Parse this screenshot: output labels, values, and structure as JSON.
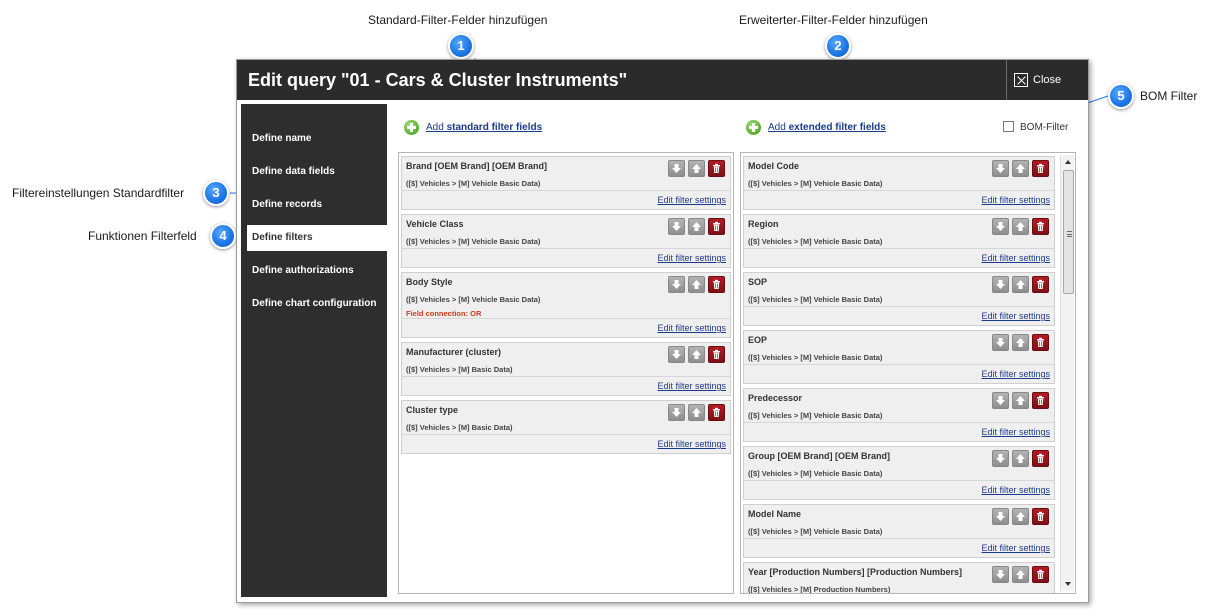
{
  "annotations": {
    "a1": {
      "num": "1",
      "label": "Standard-Filter-Felder hinzufügen"
    },
    "a2": {
      "num": "2",
      "label": "Erweiterter-Filter-Felder hinzufügen"
    },
    "a3": {
      "num": "3",
      "label": "Filtereinstellungen Standardfilter"
    },
    "a4": {
      "num": "4",
      "label": "Funktionen Filterfeld"
    },
    "a5": {
      "num": "5",
      "label": "BOM Filter"
    }
  },
  "dialog": {
    "title": "Edit query \"01 - Cars & Cluster Instruments\"",
    "close_label": "Close"
  },
  "sidebar": {
    "items": [
      {
        "label": "Define name"
      },
      {
        "label": "Define data fields"
      },
      {
        "label": "Define records"
      },
      {
        "label": "Define filters"
      },
      {
        "label": "Define authorizations"
      },
      {
        "label": "Define chart configuration"
      }
    ]
  },
  "toolbar": {
    "add_standard_prefix": "Add ",
    "add_standard_bold": "standard filter fields",
    "add_extended_prefix": "Add ",
    "add_extended_bold": "extended filter fields",
    "bom_label": "BOM-Filter"
  },
  "edit_label": "Edit filter settings",
  "standard_filters": [
    {
      "name": "Brand [OEM Brand] [OEM Brand]",
      "path": "([$] Vehicles > [M] Vehicle Basic Data)",
      "connection": ""
    },
    {
      "name": "Vehicle Class",
      "path": "([$] Vehicles > [M] Vehicle Basic Data)",
      "connection": ""
    },
    {
      "name": "Body Style",
      "path": "([$] Vehicles > [M] Vehicle Basic Data)",
      "connection": "Field connection: OR"
    },
    {
      "name": "Manufacturer (cluster)",
      "path": "([$] Vehicles > [M] Basic Data)",
      "connection": ""
    },
    {
      "name": "Cluster type",
      "path": "([$] Vehicles > [M] Basic Data)",
      "connection": ""
    }
  ],
  "extended_filters": [
    {
      "name": "Model Code",
      "path": "([$] Vehicles > [M] Vehicle Basic Data)"
    },
    {
      "name": "Region",
      "path": "([$] Vehicles > [M] Vehicle Basic Data)"
    },
    {
      "name": "SOP",
      "path": "([$] Vehicles > [M] Vehicle Basic Data)"
    },
    {
      "name": "EOP",
      "path": "([$] Vehicles > [M] Vehicle Basic Data)"
    },
    {
      "name": "Predecessor",
      "path": "([$] Vehicles > [M] Vehicle Basic Data)"
    },
    {
      "name": "Group [OEM Brand] [OEM Brand]",
      "path": "([$] Vehicles > [M] Vehicle Basic Data)"
    },
    {
      "name": "Model Name",
      "path": "([$] Vehicles > [M] Vehicle Basic Data)"
    },
    {
      "name": "Year [Production Numbers] [Production Numbers]",
      "path": "([$] Vehicles > [M] Production Numbers)"
    }
  ]
}
